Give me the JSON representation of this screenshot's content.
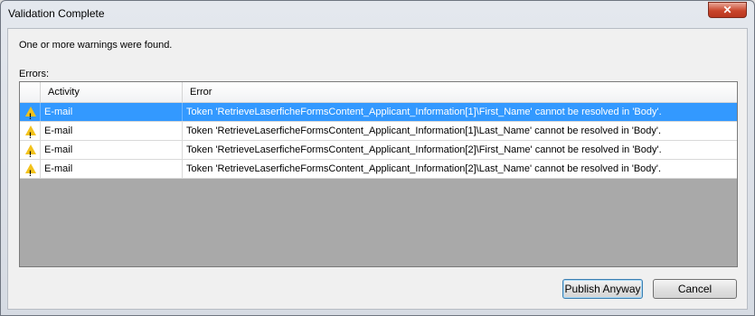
{
  "window": {
    "title": "Validation Complete",
    "close_label": "✕"
  },
  "message": "One or more warnings were found.",
  "errors_label": "Errors:",
  "table": {
    "columns": [
      "Activity",
      "Error"
    ],
    "rows": [
      {
        "icon": "warning-icon",
        "activity": "E-mail",
        "error": "Token 'RetrieveLaserficheFormsContent_Applicant_Information[1]\\First_Name' cannot be resolved in 'Body'.",
        "selected": true
      },
      {
        "icon": "warning-icon",
        "activity": "E-mail",
        "error": "Token 'RetrieveLaserficheFormsContent_Applicant_Information[1]\\Last_Name' cannot be resolved in 'Body'.",
        "selected": false
      },
      {
        "icon": "warning-icon",
        "activity": "E-mail",
        "error": "Token 'RetrieveLaserficheFormsContent_Applicant_Information[2]\\First_Name' cannot be resolved in 'Body'.",
        "selected": false
      },
      {
        "icon": "warning-icon",
        "activity": "E-mail",
        "error": "Token 'RetrieveLaserficheFormsContent_Applicant_Information[2]\\Last_Name' cannot be resolved in 'Body'.",
        "selected": false
      }
    ]
  },
  "buttons": {
    "publish": "Publish Anyway",
    "cancel": "Cancel"
  },
  "colors": {
    "selection": "#3399ff",
    "close_button": "#c9462c",
    "warning": "#f2c21b"
  }
}
